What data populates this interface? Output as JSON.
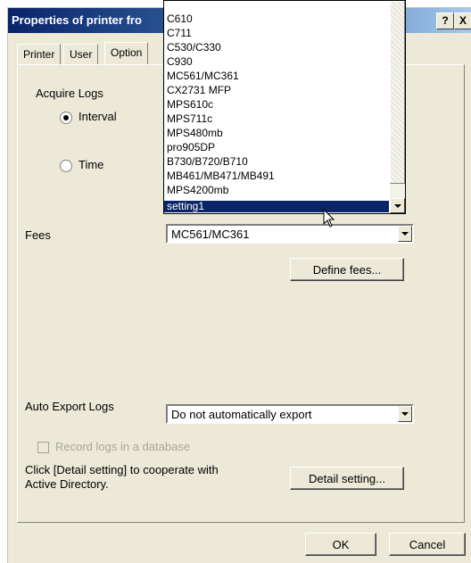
{
  "window": {
    "title": "Properties of printer fro",
    "help_label": "?",
    "close_label": "X"
  },
  "tabs": [
    {
      "label": "Printer"
    },
    {
      "label": "User"
    },
    {
      "label": "Option"
    }
  ],
  "acquire_logs": {
    "label": "Acquire Logs",
    "interval_label": "Interval",
    "interval_selected": true,
    "time_label": "Time",
    "time_selected": false
  },
  "dropdown": {
    "items": [
      "C610",
      "C711",
      "C530/C330",
      "C930",
      "MC561/MC361",
      "CX2731 MFP",
      "MPS610c",
      "MPS711c",
      "MPS480mb",
      "pro905DP",
      "B730/B720/B710",
      "MB461/MB471/MB491",
      "MPS4200mb"
    ],
    "selected_item": "setting1"
  },
  "fees": {
    "label": "Fees",
    "value": "MC561/MC361",
    "define_button": "Define fees..."
  },
  "auto_export": {
    "label": "Auto Export Logs",
    "value": "Do not automatically export"
  },
  "record_db": {
    "label": "Record logs in a database",
    "checked": false
  },
  "active_directory": {
    "line1": "Click [Detail setting] to cooperate with",
    "line2": "Active Directory.",
    "button": "Detail setting..."
  },
  "footer": {
    "ok_label": "OK",
    "cancel_label": "Cancel"
  }
}
